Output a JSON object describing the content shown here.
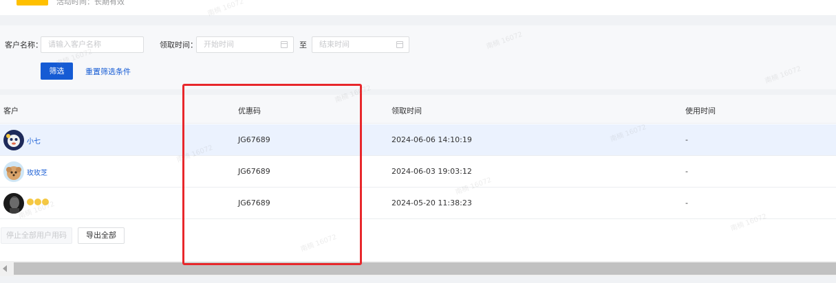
{
  "top": {
    "text": "活动时间：长期有效"
  },
  "filters": {
    "customer_label": "客户名称：",
    "customer_placeholder": "请输入客户名称",
    "time_label": "领取时间：",
    "start_placeholder": "开始时间",
    "range_sep": "至",
    "end_placeholder": "结束时间",
    "filter_button": "筛选",
    "reset_link": "重置筛选条件"
  },
  "table": {
    "columns": [
      "客户",
      "优惠码",
      "领取时间",
      "使用时间"
    ],
    "rows": [
      {
        "name": "小七",
        "code": "JG67689",
        "received": "2024-06-06 14:10:19",
        "used": "-"
      },
      {
        "name": "玫玫芝",
        "code": "JG67689",
        "received": "2024-06-03 19:03:12",
        "used": "-"
      },
      {
        "name": "",
        "code": "JG67689",
        "received": "2024-05-20 11:38:23",
        "used": "-"
      }
    ]
  },
  "footer": {
    "stop_all_button": "停止全部用户用码",
    "export_all_button": "导出全部"
  },
  "watermark_text": "南楠 16072",
  "colors": {
    "primary": "#155bd4",
    "highlight": "#e8272b",
    "selected_row": "#ebf2fe"
  }
}
